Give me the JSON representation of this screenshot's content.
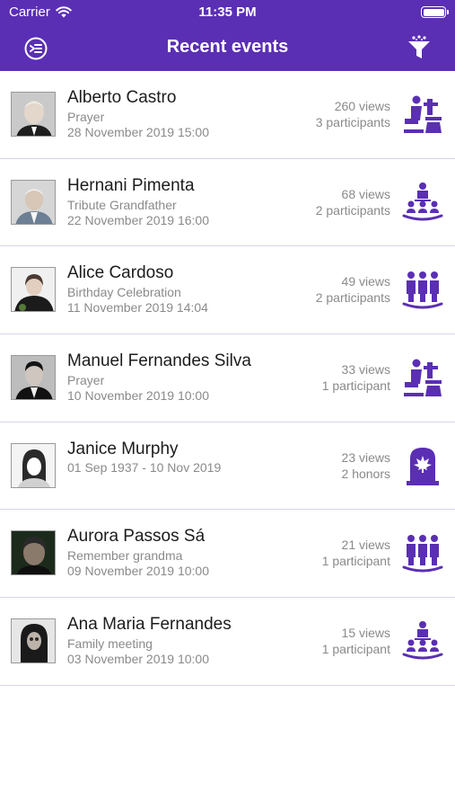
{
  "status_bar": {
    "carrier": "Carrier",
    "time": "11:35 PM"
  },
  "nav": {
    "title": "Recent events",
    "left_icon": "exit-menu-icon",
    "right_icon": "filter-icon"
  },
  "colors": {
    "brand": "#5a2fb3",
    "divider": "#d8d3ec",
    "secondary_text": "#8a8a8a"
  },
  "events": [
    {
      "name": "Alberto Castro",
      "subtitle": "Prayer",
      "date": "28 November 2019 15:00",
      "views": "260 views",
      "participants": "3 participants",
      "icon": "prayer-icon"
    },
    {
      "name": "Hernani Pimenta",
      "subtitle": "Tribute Grandfather",
      "date": "22 November 2019 16:00",
      "views": "68 views",
      "participants": "2 participants",
      "icon": "meeting-icon"
    },
    {
      "name": "Alice Cardoso",
      "subtitle": "Birthday Celebration",
      "date": "11 November 2019 14:04",
      "views": "49 views",
      "participants": "2 participants",
      "icon": "group-icon"
    },
    {
      "name": "Manuel Fernandes Silva",
      "subtitle": "Prayer",
      "date": "10 November 2019 10:00",
      "views": "33 views",
      "participants": "1 participant",
      "icon": "prayer-icon"
    },
    {
      "name": "Janice Murphy",
      "subtitle": "",
      "date": "01 Sep 1937 - 10 Nov 2019",
      "views": "23 views",
      "participants": "2 honors",
      "icon": "tombstone-icon"
    },
    {
      "name": "Aurora Passos Sá",
      "subtitle": "Remember grandma",
      "date": "09 November 2019 10:00",
      "views": "21 views",
      "participants": "1 participant",
      "icon": "group-icon"
    },
    {
      "name": "Ana Maria Fernandes",
      "subtitle": "Family meeting",
      "date": "03 November 2019 10:00",
      "views": "15 views",
      "participants": "1 participant",
      "icon": "meeting-icon"
    }
  ]
}
